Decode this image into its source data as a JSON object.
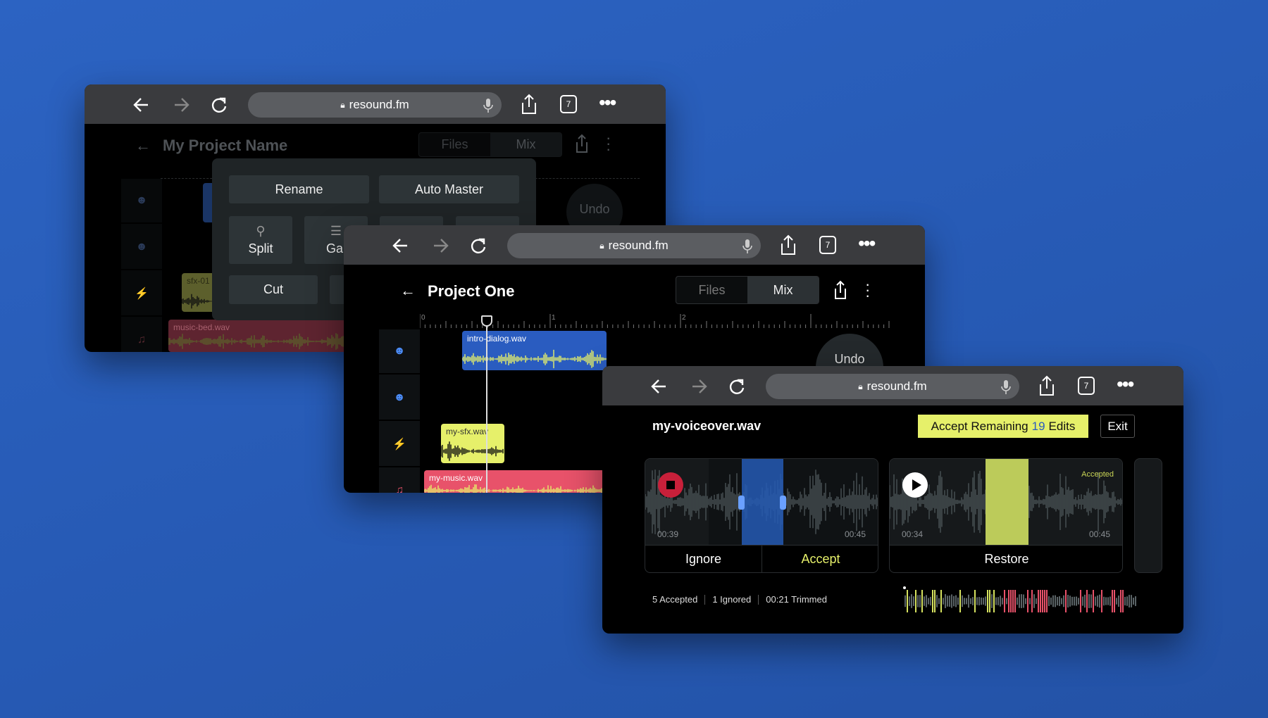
{
  "colors": {
    "background": "#2659b3",
    "accent_yellow": "#e6f06a",
    "clip_blue": "#2a5cc0",
    "clip_red": "#e8526a",
    "record_red": "#c8203a"
  },
  "browser": {
    "url": "resound.fm",
    "tab_count": "7"
  },
  "window_back": {
    "title": "My Project Name",
    "tabs": [
      "Files",
      "Mix"
    ],
    "active_tab": "Mix",
    "undo": "Undo",
    "menu": {
      "rename": "Rename",
      "auto_master": "Auto Master",
      "split": "Split",
      "gain": "Gai",
      "cut": "Cut"
    },
    "clips": {
      "sfx": "sfx-01",
      "music": "music-bed.wav"
    }
  },
  "window_middle": {
    "title": "Project One",
    "tabs": [
      "Files",
      "Mix"
    ],
    "active_tab": "Mix",
    "ruler": [
      "0",
      "1",
      "2"
    ],
    "undo": "Undo",
    "clips": {
      "dialog": "intro-dialog.wav",
      "sfx": "my-sfx.wav",
      "music": "my-music.wav"
    }
  },
  "window_front": {
    "filename": "my-voiceover.wav",
    "accept_prefix": "Accept Remaining",
    "accept_count": "19",
    "accept_suffix": "Edits",
    "exit": "Exit",
    "cards": [
      {
        "start": "00:39",
        "end": "00:45",
        "ignore": "Ignore",
        "accept": "Accept"
      },
      {
        "start": "00:34",
        "end": "00:45",
        "status": "Accepted",
        "restore": "Restore"
      }
    ],
    "stats": {
      "accepted": "5 Accepted",
      "ignored": "1 Ignored",
      "trimmed": "00:21 Trimmed"
    }
  }
}
